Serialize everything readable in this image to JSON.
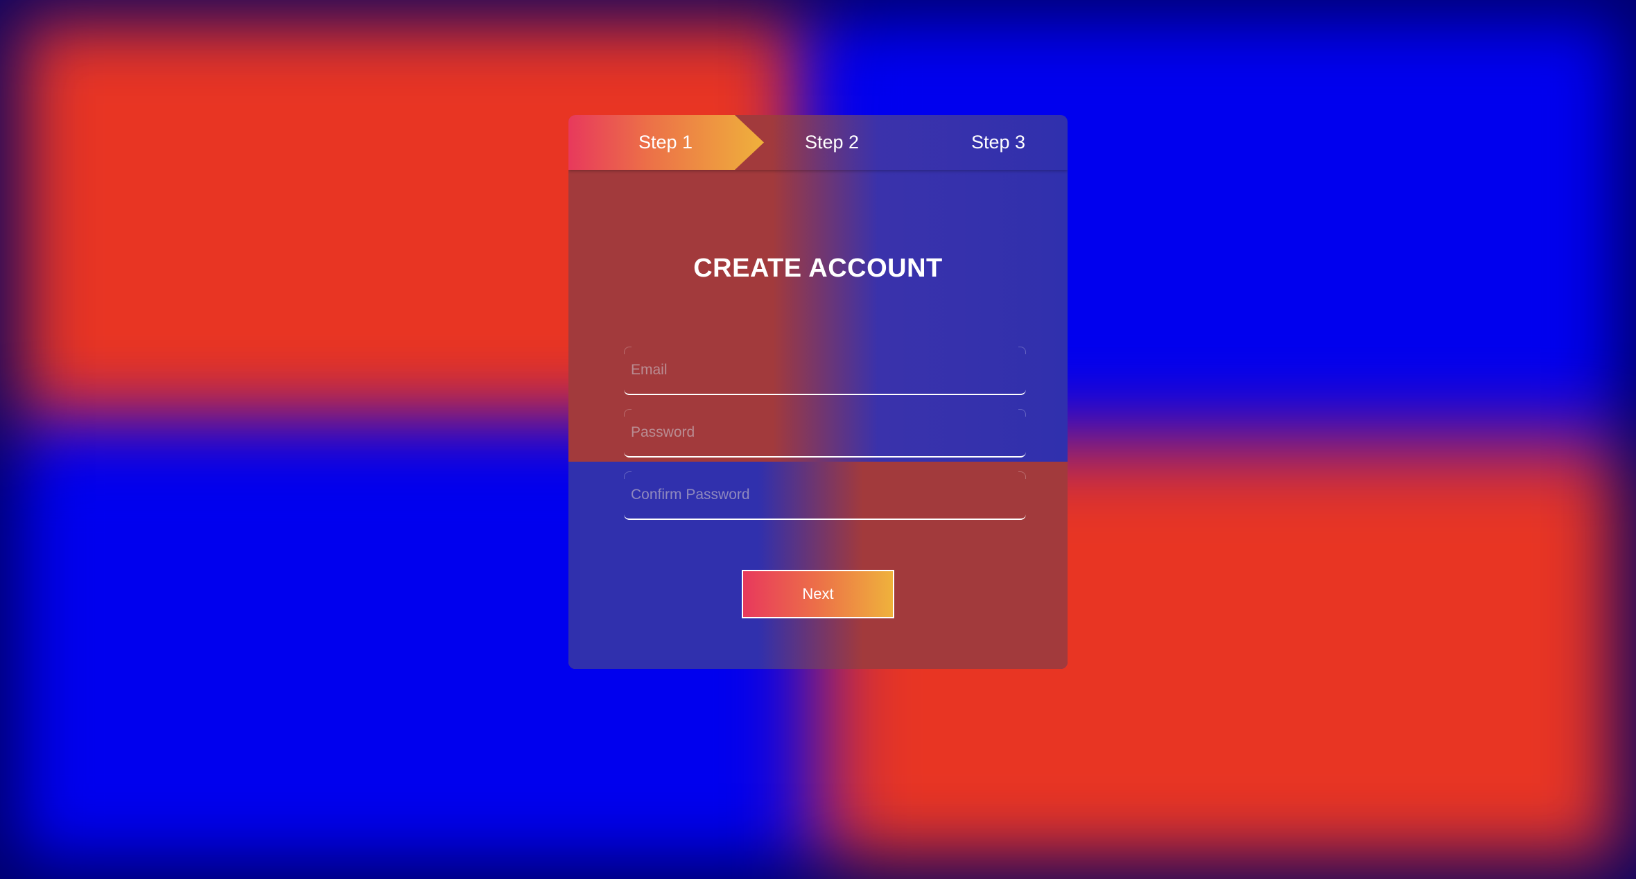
{
  "steps": [
    {
      "label": "Step 1",
      "active": true
    },
    {
      "label": "Step 2",
      "active": false
    },
    {
      "label": "Step 3",
      "active": false
    }
  ],
  "form": {
    "title": "CREATE ACCOUNT",
    "fields": {
      "email": {
        "value": "",
        "placeholder": "Email"
      },
      "password": {
        "value": "",
        "placeholder": "Password"
      },
      "confirm_password": {
        "value": "",
        "placeholder": "Confirm Password"
      }
    },
    "next_label": "Next"
  },
  "colors": {
    "background_red": "#e83523",
    "background_blue": "#0000ee",
    "accent_start": "#e8395c",
    "accent_end": "#efb13c",
    "text": "#ffffff"
  }
}
